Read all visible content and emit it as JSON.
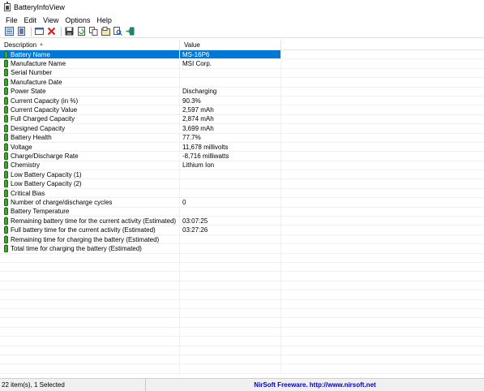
{
  "window": {
    "title": "BatteryInfoView"
  },
  "menu": [
    "File",
    "Edit",
    "View",
    "Options",
    "Help"
  ],
  "toolbar": {
    "buttons": [
      "properties-icon",
      "report-icon",
      "options-icon",
      "delete-icon",
      "save-icon",
      "refresh-icon",
      "copy-icon",
      "html-report-icon",
      "find-icon",
      "exit-icon"
    ]
  },
  "table": {
    "columns": [
      "Description",
      "Value"
    ],
    "rows": [
      {
        "desc": "Battery Name",
        "value": "MS-16P6"
      },
      {
        "desc": "Manufacture Name",
        "value": "MSI Corp."
      },
      {
        "desc": "Serial Number",
        "value": ""
      },
      {
        "desc": "Manufacture Date",
        "value": ""
      },
      {
        "desc": "Power State",
        "value": "Discharging"
      },
      {
        "desc": "Current Capacity (in %)",
        "value": "90.3%"
      },
      {
        "desc": "Current Capacity Value",
        "value": "2,597 mAh"
      },
      {
        "desc": "Full Charged Capacity",
        "value": "2,874 mAh"
      },
      {
        "desc": "Designed Capacity",
        "value": "3,699 mAh"
      },
      {
        "desc": "Battery Health",
        "value": "77.7%"
      },
      {
        "desc": "Voltage",
        "value": "11,678 millivolts"
      },
      {
        "desc": "Charge/Discharge Rate",
        "value": "-8,716 milliwatts"
      },
      {
        "desc": "Chemistry",
        "value": "Lithium Ion"
      },
      {
        "desc": "Low Battery Capacity (1)",
        "value": ""
      },
      {
        "desc": "Low Battery Capacity (2)",
        "value": ""
      },
      {
        "desc": "Critical Bias",
        "value": ""
      },
      {
        "desc": "Number of charge/discharge cycles",
        "value": "0"
      },
      {
        "desc": "Battery Temperature",
        "value": ""
      },
      {
        "desc": "Remaining battery time for the current activity (Estimated)",
        "value": "03:07:25"
      },
      {
        "desc": "Full battery time for the current activity (Estimated)",
        "value": "03:27:26"
      },
      {
        "desc": "Remaining time for charging the battery (Estimated)",
        "value": ""
      },
      {
        "desc": "Total  time for charging the battery (Estimated)",
        "value": ""
      }
    ],
    "selected_index": 0,
    "empty_rows": 13
  },
  "status": {
    "count": "22 item(s), 1 Selected",
    "credit": "NirSoft Freeware.  http://www.nirsoft.net"
  },
  "colors": {
    "selection": "#0078d7",
    "battery": "#3fa52a",
    "credit": "#0000cc"
  }
}
